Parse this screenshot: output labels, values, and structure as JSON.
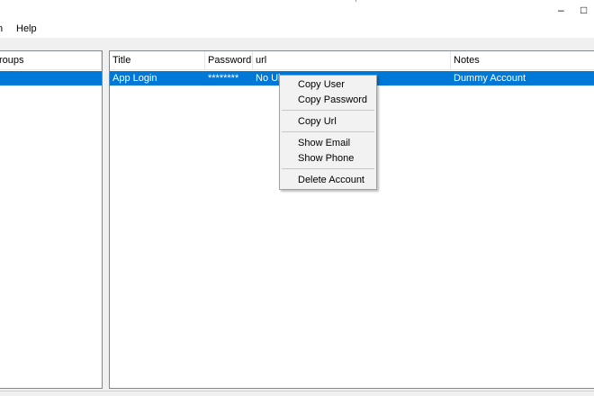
{
  "window": {
    "minimize": "–",
    "maximize": "□"
  },
  "menubar": {
    "items": [
      "n",
      "Help"
    ]
  },
  "groups_pane": {
    "header": "roups",
    "selected_row": ""
  },
  "accounts_table": {
    "columns": [
      "Title",
      "Password",
      "url",
      "Notes"
    ],
    "rows": [
      {
        "title": "App Login",
        "password": "********",
        "url": "No Ul",
        "notes": "Dummy Account",
        "selected": true
      }
    ]
  },
  "context_menu": {
    "items": [
      {
        "label": "Copy User"
      },
      {
        "label": "Copy Password"
      },
      {
        "label": "Copy Url"
      },
      {
        "label": "Show Email"
      },
      {
        "label": "Show Phone"
      },
      {
        "label": "Delete Account"
      }
    ]
  },
  "colors": {
    "selection": "#0078d7",
    "menu_background": "#f2f2f2",
    "window_background": "#f0f0f0"
  }
}
